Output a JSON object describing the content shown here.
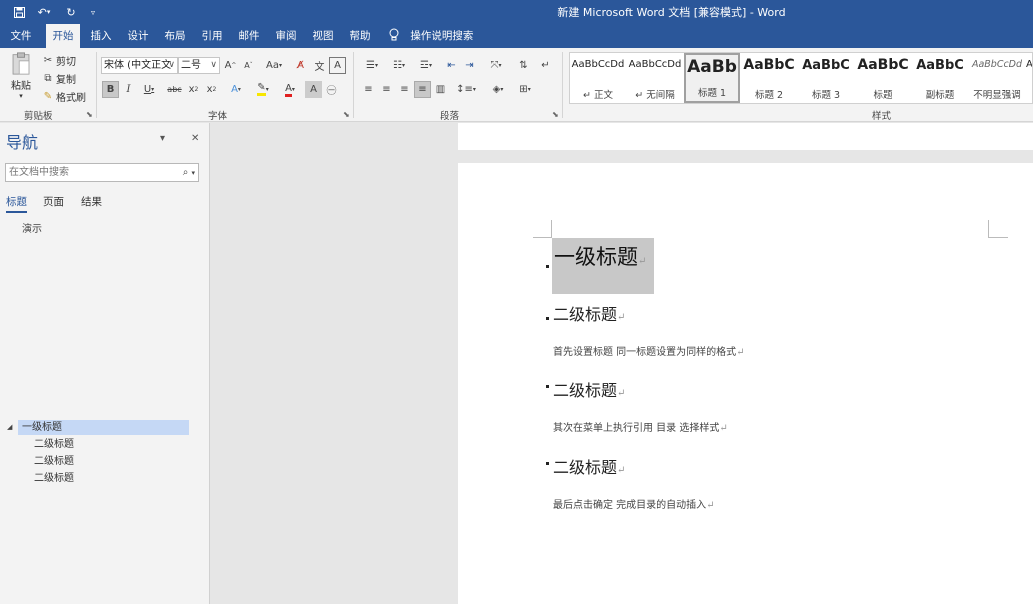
{
  "window": {
    "title": "新建 Microsoft Word 文档 [兼容模式]  -  Word"
  },
  "tabs": [
    "文件",
    "开始",
    "插入",
    "设计",
    "布局",
    "引用",
    "邮件",
    "审阅",
    "视图",
    "帮助"
  ],
  "tell_me": "操作说明搜索",
  "ribbon": {
    "clipboard": {
      "paste": "粘贴",
      "cut": "剪切",
      "copy": "复制",
      "format_painter": "格式刷",
      "label": "剪贴板"
    },
    "font": {
      "font_name": "宋体 (中文正文",
      "font_size": "二号",
      "label": "字体"
    },
    "paragraph": {
      "label": "段落"
    },
    "styles": {
      "label": "样式",
      "items": [
        {
          "sample": "AaBbCcDd",
          "name": "↵ 正文"
        },
        {
          "sample": "AaBbCcDd",
          "name": "↵ 无间隔"
        },
        {
          "sample": "AaBb",
          "name": "标题 1"
        },
        {
          "sample": "AaBbC",
          "name": "标题 2"
        },
        {
          "sample": "AaBbC",
          "name": "标题 3"
        },
        {
          "sample": "AaBbC",
          "name": "标题"
        },
        {
          "sample": "AaBbC",
          "name": "副标题"
        },
        {
          "sample": "AaBbCcDd",
          "name": "不明显强调"
        },
        {
          "sample": "A",
          "name": ""
        }
      ]
    }
  },
  "nav": {
    "title": "导航",
    "search_placeholder": "在文档中搜索",
    "tabs": [
      "标题",
      "页面",
      "结果"
    ],
    "result_text": "演示",
    "tree": [
      "一级标题",
      "二级标题",
      "二级标题",
      "二级标题"
    ]
  },
  "document": {
    "h1": "一级标题",
    "sections": [
      {
        "heading": "二级标题",
        "body": "首先设置标题  同一标题设置为同样的格式"
      },
      {
        "heading": "二级标题",
        "body": "其次在菜单上执行引用  目录  选择样式"
      },
      {
        "heading": "二级标题",
        "body": "最后点击确定  完成目录的自动插入"
      }
    ],
    "para_mark": "↵"
  }
}
